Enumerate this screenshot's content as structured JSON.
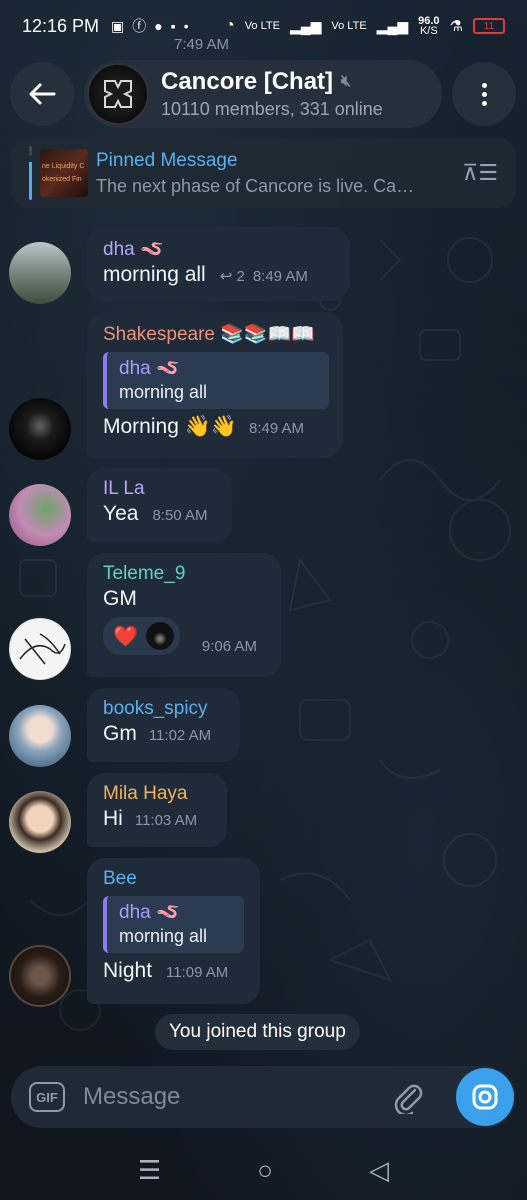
{
  "status_bar": {
    "time": "12:16 PM",
    "left_icons": [
      "chat-icon",
      "facebook-icon",
      "message-icon",
      "bag-icon",
      "dot-icon"
    ],
    "network_1": "Vo LTE",
    "network_2": "Vo LTE",
    "speed": "96.0",
    "speed_unit": "K/S",
    "battery": "11"
  },
  "ghost_time": "7:49 AM",
  "header": {
    "title": "Cancore [Chat]",
    "subtitle": "10110 members, 331 online"
  },
  "pinned": {
    "title": "Pinned Message",
    "text": "The next phase of Cancore is live.  Ca…",
    "thumb_line1": "ne Liquidity C",
    "thumb_line2": "okenized Fin"
  },
  "messages": [
    {
      "sender": "dha 🪱",
      "sender_color": "#b5a6f5",
      "text": "morning all",
      "replies": "2",
      "time": "8:49 AM"
    },
    {
      "sender": "Shakespeare 📚📚📖📖",
      "sender_color": "#f08f7a",
      "quote_name": "dha 🪱",
      "quote_text": "morning all",
      "text": "Morning 👋👋",
      "time": "8:49 AM"
    },
    {
      "sender": "IL La",
      "sender_color": "#b5a6f5",
      "text": "Yea",
      "time": "8:50 AM"
    },
    {
      "sender": "Teleme_9",
      "sender_color": "#5fd2c0",
      "text": "GM",
      "reaction": "❤️",
      "time": "9:06 AM"
    },
    {
      "sender": "books_spicy",
      "sender_color": "#5ab0ee",
      "text": "Gm",
      "time": "11:02 AM"
    },
    {
      "sender": "Mila Haya",
      "sender_color": "#f2b35c",
      "text": "Hi",
      "time": "11:03 AM"
    },
    {
      "sender": "Bee",
      "sender_color": "#5ab0ee",
      "quote_name": "dha 🪱",
      "quote_text": "morning all",
      "text": "Night",
      "time": "11:09 AM"
    }
  ],
  "system_message": "You joined this group",
  "composer": {
    "gif_label": "GIF",
    "placeholder": "Message"
  }
}
